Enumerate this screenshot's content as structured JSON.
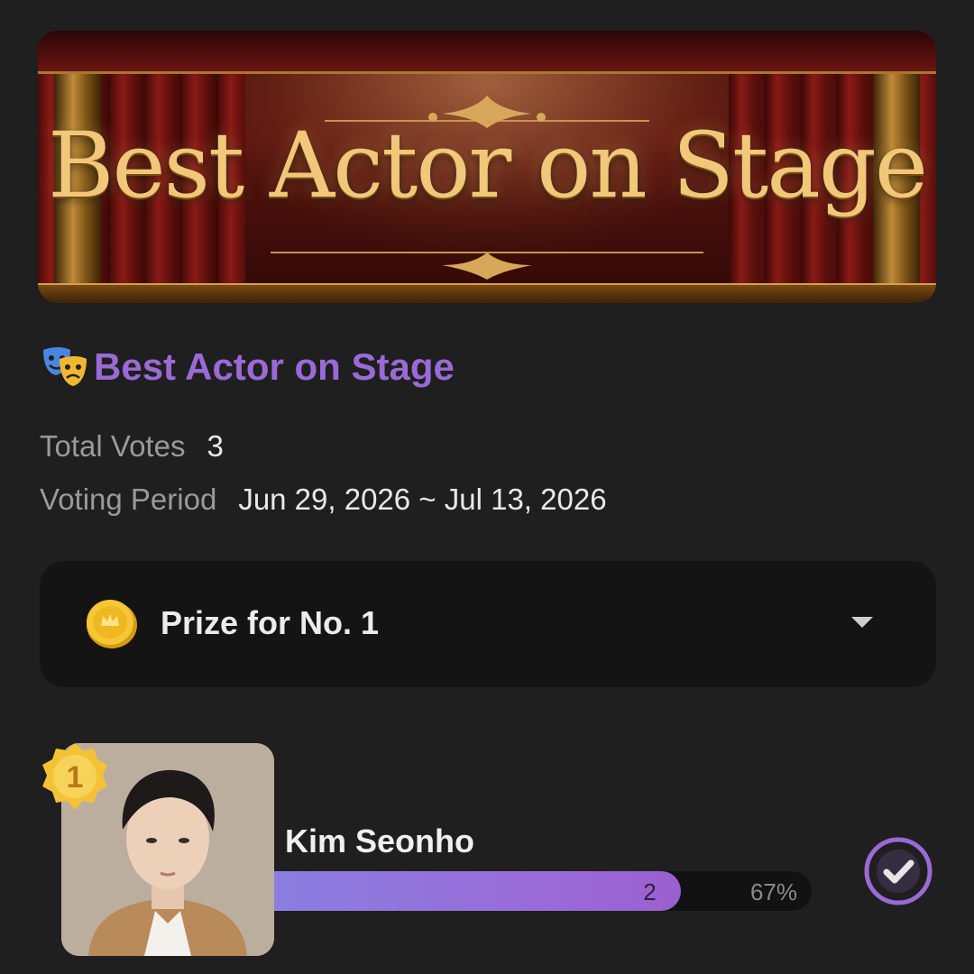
{
  "banner": {
    "title": "Best Actor on Stage"
  },
  "header": {
    "icon": "theater-masks-icon",
    "title": "Best Actor on Stage"
  },
  "info": {
    "total_votes_label": "Total Votes",
    "total_votes_value": "3",
    "period_label": "Voting Period",
    "period_value": "Jun 29, 2026 ~ Jul 13, 2026"
  },
  "prize": {
    "icon": "gold-coin-icon",
    "label": "Prize for No. 1",
    "toggle_icon": "chevron-down-icon"
  },
  "candidates": [
    {
      "rank": "1",
      "name": "Kim Seonho",
      "votes": "2",
      "percent_label": "67%",
      "percent": 0.67,
      "voted": true
    }
  ],
  "colors": {
    "background": "#1f1f1f",
    "accent": "#9a6ad6",
    "card": "#141414",
    "label": "#9a9a9a"
  }
}
